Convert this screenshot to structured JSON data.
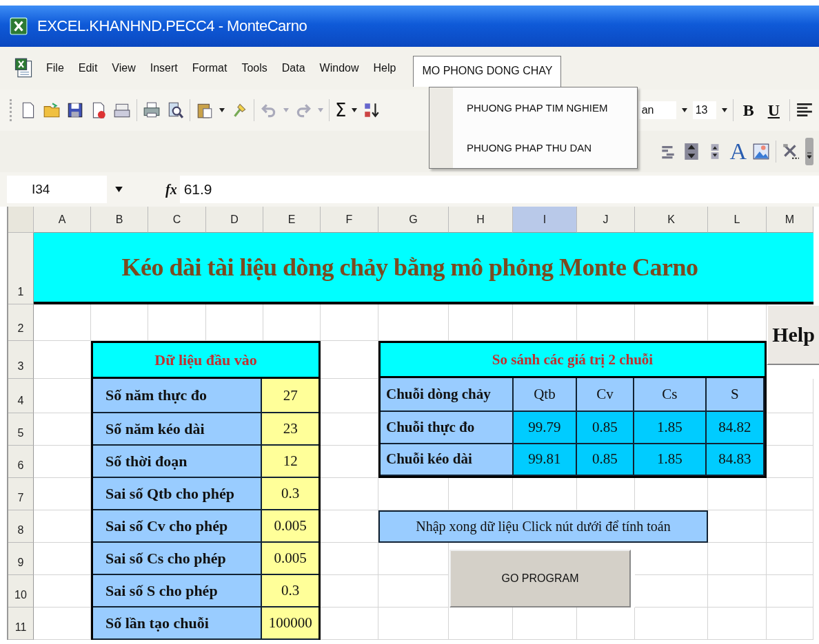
{
  "window": {
    "title": "EXCEL.KHANHND.PECC4 - MonteCarno"
  },
  "menu_bar": {
    "items": [
      {
        "label": "File",
        "selected": false
      },
      {
        "label": "Edit",
        "selected": false
      },
      {
        "label": "View",
        "selected": false
      },
      {
        "label": "Insert",
        "selected": false
      },
      {
        "label": "Format",
        "selected": false
      },
      {
        "label": "Tools",
        "selected": false
      },
      {
        "label": "Data",
        "selected": false
      },
      {
        "label": "Window",
        "selected": false
      },
      {
        "label": "Help",
        "selected": false
      },
      {
        "label": "MO PHONG DONG CHAY",
        "selected": true
      }
    ]
  },
  "open_menu": {
    "items": [
      "PHUONG PHAP TIM NGHIEM",
      "PHUONG PHAP THU DAN"
    ]
  },
  "standard_toolbar": {
    "autosum": "Σ"
  },
  "formatting_toolbar": {
    "font": "an",
    "font_size": "13",
    "bold": "B",
    "underline": "U"
  },
  "drawing_toolbar": {
    "wordart": "A"
  },
  "formula_bar": {
    "name_box": "I34",
    "function_label": "fx",
    "value": "61.9"
  },
  "sheet": {
    "columns": [
      {
        "label": "A",
        "selected": false
      },
      {
        "label": "B",
        "selected": false
      },
      {
        "label": "C",
        "selected": false
      },
      {
        "label": "D",
        "selected": false
      },
      {
        "label": "E",
        "selected": false
      },
      {
        "label": "F",
        "selected": false
      },
      {
        "label": "G",
        "selected": false
      },
      {
        "label": "H",
        "selected": false
      },
      {
        "label": "I",
        "selected": true
      },
      {
        "label": "J",
        "selected": false
      },
      {
        "label": "K",
        "selected": false
      },
      {
        "label": "L",
        "selected": false
      },
      {
        "label": "M",
        "selected": false
      }
    ],
    "rows": [
      "1",
      "2",
      "3",
      "4",
      "5",
      "6",
      "7",
      "8",
      "9",
      "10",
      "11"
    ],
    "title": "Kéo dài tài liệu dòng chảy bằng mô phỏng Monte Carno",
    "input_table": {
      "title": "Dữ liệu đầu vào",
      "rows": [
        {
          "label": "Số năm thực đo",
          "value": "27"
        },
        {
          "label": "Số năm kéo dài",
          "value": "23"
        },
        {
          "label": "Số thời đoạn",
          "value": "12"
        },
        {
          "label": "Sai số Qtb cho phép",
          "value": "0.3"
        },
        {
          "label": "Sai số Cv cho phép",
          "value": "0.005"
        },
        {
          "label": "Sai số Cs cho phép",
          "value": "0.005"
        },
        {
          "label": "Sai số S cho phép",
          "value": "0.3"
        },
        {
          "label": "Số lần tạo chuỗi",
          "value": "100000"
        }
      ]
    },
    "compare_table": {
      "title": "So sánh các giá trị 2 chuỗi",
      "columns": [
        "Chuỗi dòng chảy",
        "Qtb",
        "Cv",
        "Cs",
        "S"
      ],
      "rows": [
        {
          "label": "Chuỗi thực đo",
          "values": [
            "99.79",
            "0.85",
            "1.85",
            "84.82"
          ]
        },
        {
          "label": "Chuỗi kéo dài",
          "values": [
            "99.81",
            "0.85",
            "1.85",
            "84.83"
          ]
        }
      ]
    },
    "note": "Nhập xong dữ liệu Click nút dưới để tính toán",
    "run_button": "GO PROGRAM",
    "help_button": "Help"
  }
}
